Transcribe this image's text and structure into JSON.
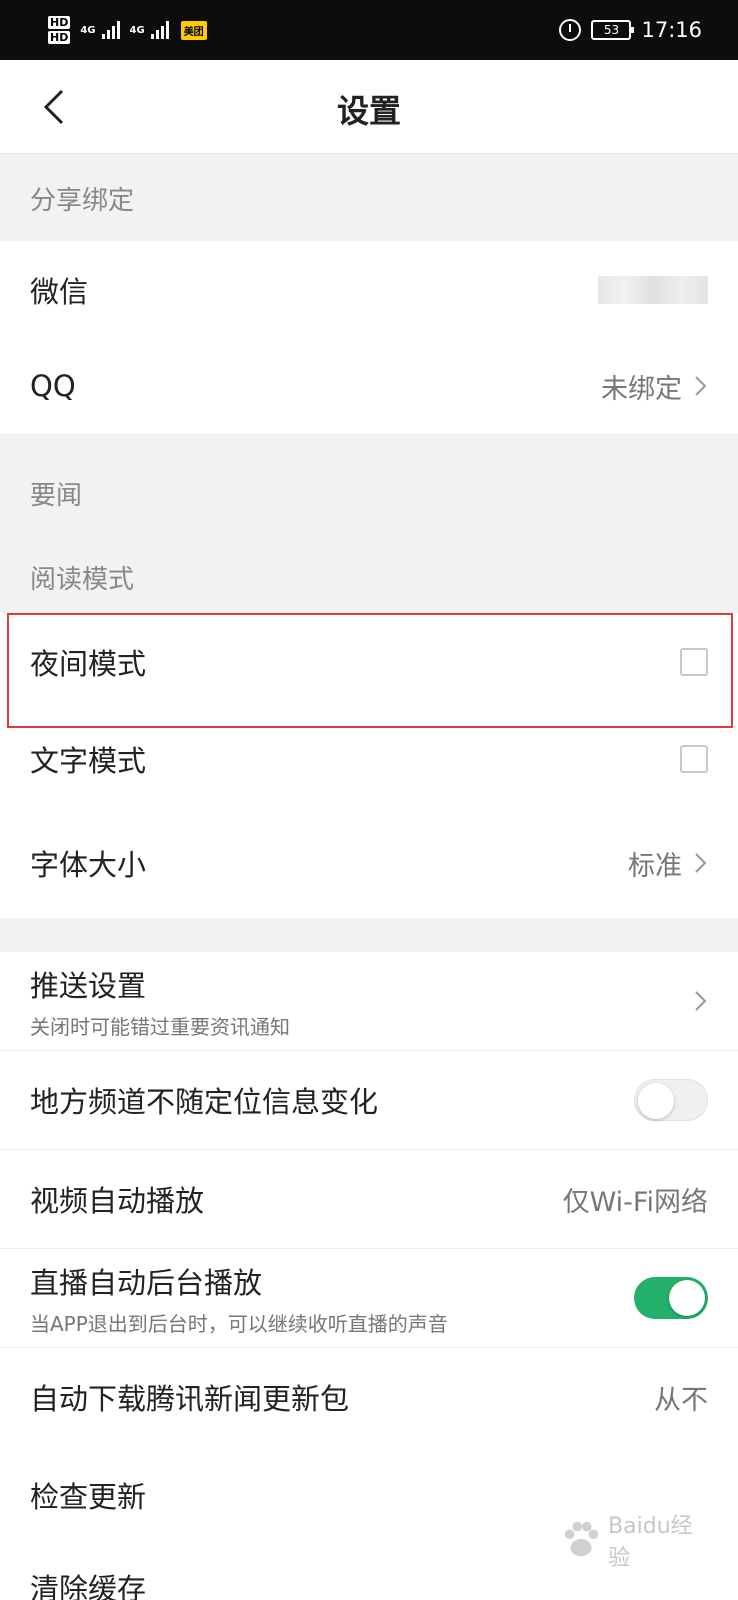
{
  "status_bar": {
    "hd1": "HD",
    "hd2": "HD",
    "net1": "4G",
    "net2": "4G",
    "carrier_badge": "美团",
    "battery": "53",
    "time": "17:16"
  },
  "nav": {
    "title": "设置"
  },
  "sections": {
    "share": "分享绑定",
    "news": "要闻",
    "reading": "阅读模式"
  },
  "rows": {
    "wechat": {
      "label": "微信"
    },
    "qq": {
      "label": "QQ",
      "value": "未绑定"
    },
    "night_mode": {
      "label": "夜间模式",
      "checked": false
    },
    "text_mode": {
      "label": "文字模式",
      "checked": false
    },
    "font_size": {
      "label": "字体大小",
      "value": "标准"
    },
    "push": {
      "label": "推送设置",
      "sub": "关闭时可能错过重要资讯通知"
    },
    "local_channel": {
      "label": "地方频道不随定位信息变化",
      "enabled": false
    },
    "video_autoplay": {
      "label": "视频自动播放",
      "value": "仅Wi-Fi网络"
    },
    "live_bg": {
      "label": "直播自动后台播放",
      "sub": "当APP退出到后台时，可以继续收听直播的声音",
      "enabled": true
    },
    "auto_download": {
      "label": "自动下载腾讯新闻更新包",
      "value": "从不"
    },
    "check_update": {
      "label": "检查更新"
    },
    "clear_cache": {
      "label": "清除缓存"
    }
  },
  "colors": {
    "toggle_on": "#22b06a",
    "highlight": "#e23b3b"
  },
  "watermark": {
    "text": "Baidu经验"
  }
}
